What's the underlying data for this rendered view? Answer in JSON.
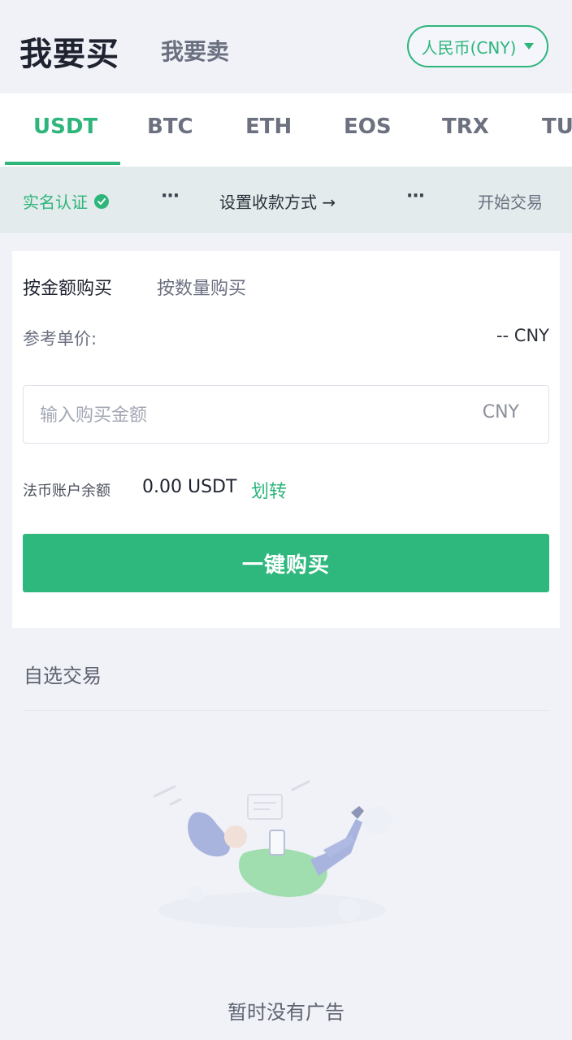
{
  "header": {
    "buy_tab": "我要买",
    "sell_tab": "我要卖",
    "currency_selector": "人民币(CNY)"
  },
  "coins": [
    "USDT",
    "BTC",
    "ETH",
    "EOS",
    "TRX",
    "TU"
  ],
  "active_coin": "USDT",
  "steps": {
    "verify": "实名认证",
    "dots": "···",
    "payment_method": "设置收款方式 →",
    "start_trading": "开始交易"
  },
  "buy_card": {
    "mode_amount": "按金额购买",
    "mode_quantity": "按数量购买",
    "ref_price_label": "参考单价:",
    "ref_price_value": "-- CNY",
    "input_placeholder": "输入购买金额",
    "input_unit": "CNY",
    "balance_label": "法币账户余额",
    "balance_value": "0.00 USDT",
    "transfer_link": "划转",
    "buy_button": "一键购买"
  },
  "custom_trade": {
    "title": "自选交易",
    "empty_text": "暂时没有广告"
  },
  "colors": {
    "accent": "#2db57a",
    "background": "#f0f2f8"
  }
}
